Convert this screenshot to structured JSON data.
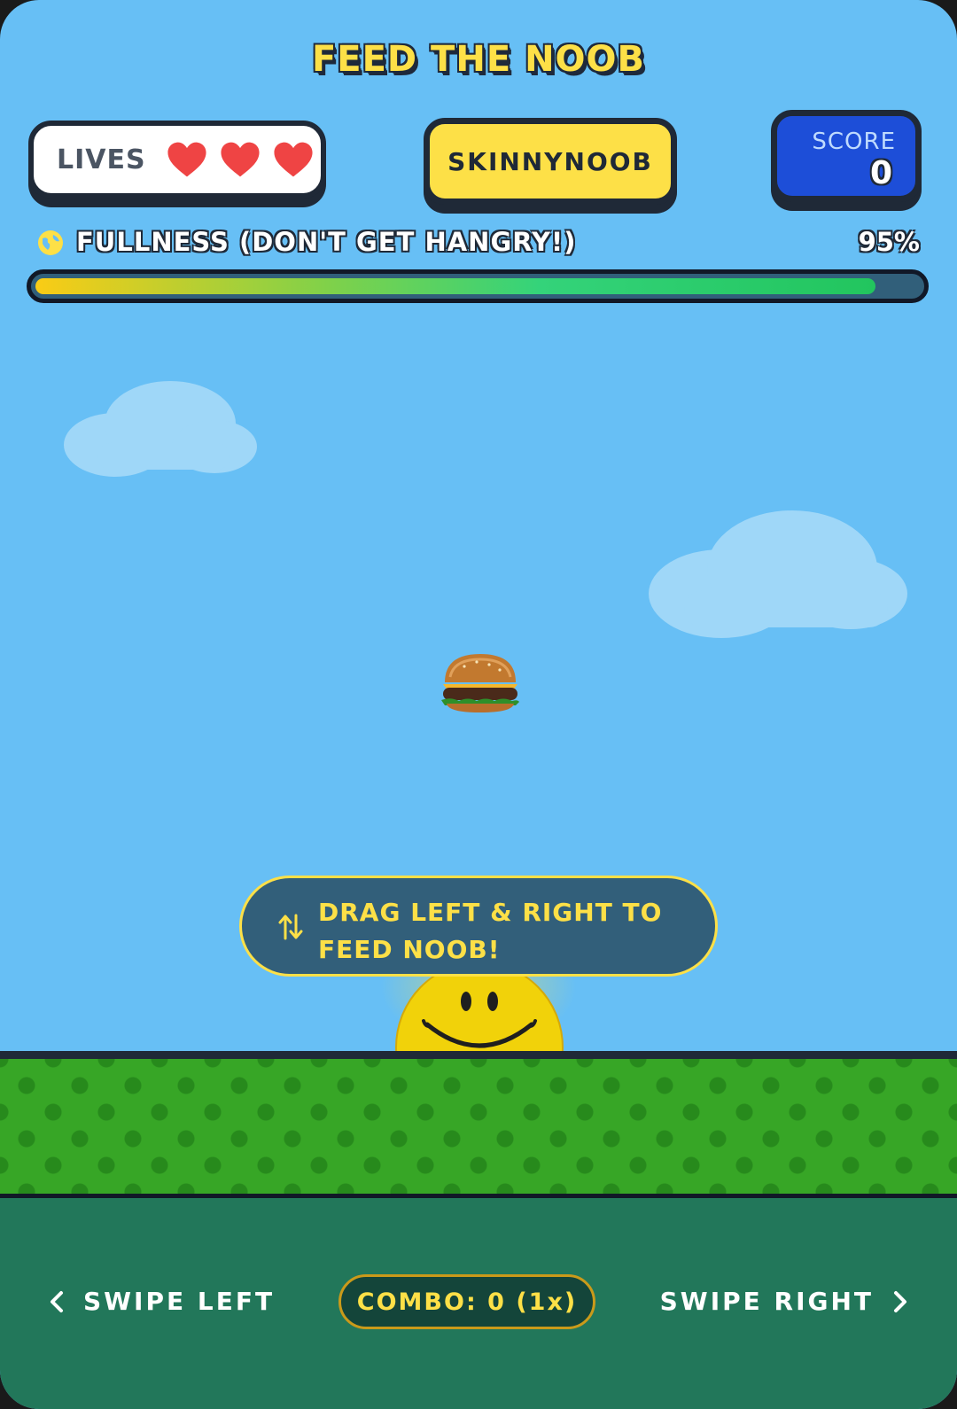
{
  "game": {
    "title": "FEED THE NOOB"
  },
  "hud": {
    "lives_label": "LIVES",
    "lives_count": 3,
    "heart_color": "#ef4444",
    "character_name": "SKINNYNOOB",
    "score_label": "SCORE",
    "score_value": "0"
  },
  "fullness": {
    "label": "FULLNESS (DON'T GET HANGRY!)",
    "percent_text": "95%",
    "percent": 95
  },
  "playfield": {
    "falling_item": "burger",
    "hint_text": "DRAG LEFT & RIGHT TO FEED NOOB!",
    "hint_icon": "swap-vertical-arrows-icon"
  },
  "controls": {
    "swipe_left": "SWIPE LEFT",
    "combo": "COMBO: 0 (1x)",
    "swipe_right": "SWIPE RIGHT"
  },
  "colors": {
    "sky": "#67bff5",
    "accent_yellow": "#fde047",
    "score_blue": "#1d4ed8",
    "grass": "#37a626",
    "footer": "#22775a"
  }
}
